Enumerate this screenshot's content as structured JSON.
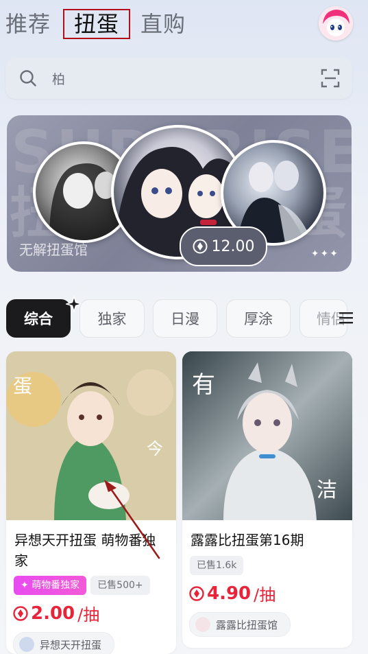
{
  "top_tabs": {
    "recommend": "推荐",
    "gacha": "扭蛋",
    "buy": "直购"
  },
  "search": {
    "text": "柏"
  },
  "banner": {
    "bg_text": "SURPRISE",
    "bg_char_left": "扭",
    "bg_char_right": "蛋",
    "shop_name": "无解扭蛋馆",
    "price": "12.00"
  },
  "categories": [
    "综合",
    "独家",
    "日漫",
    "厚涂",
    "情侣"
  ],
  "cards": [
    {
      "title": "异想天开扭蛋 萌物番独家",
      "tags": [
        {
          "label": "萌物番独家",
          "style": "pink"
        },
        {
          "label": "已售500+",
          "style": "grey"
        }
      ],
      "price": "2.00",
      "unit": "/抽",
      "shop": "异想天开扭蛋"
    },
    {
      "title": "露露比扭蛋第16期",
      "tags": [
        {
          "label": "已售1.6k",
          "style": "grey"
        }
      ],
      "price": "4.90",
      "unit": "/抽",
      "shop": "露露比扭蛋馆"
    }
  ],
  "colors": {
    "price_red": "#e8243a",
    "tab_active_border": "#b30d1a",
    "tag_pink": "#e84cf0"
  }
}
